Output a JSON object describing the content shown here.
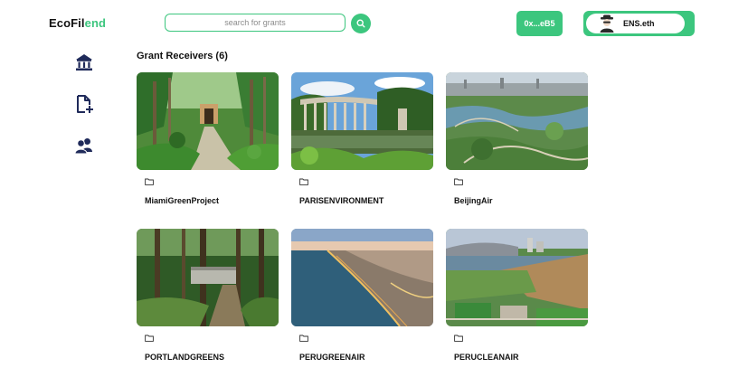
{
  "header": {
    "logo_part1": "EcoFil",
    "logo_part2": "end",
    "search_placeholder": "search for grants",
    "search_icon": "search-icon",
    "wallet_address": "0x...eB5",
    "ens_name": "ENS.eth",
    "avatar_icon": "spy-avatar-icon"
  },
  "sidebar": {
    "items": [
      {
        "icon": "bank-icon"
      },
      {
        "icon": "file-add-icon"
      },
      {
        "icon": "users-icon"
      }
    ]
  },
  "main": {
    "title": "Grant Receivers (6)",
    "cards": [
      {
        "label": "MiamiGreenProject",
        "icon": "folder-icon"
      },
      {
        "label": "PARISENVIRONMENT",
        "icon": "folder-icon"
      },
      {
        "label": "BeijingAir",
        "icon": "folder-icon"
      },
      {
        "label": "PORTLANDGREENS",
        "icon": "folder-icon"
      },
      {
        "label": "PERUGREENAIR",
        "icon": "folder-icon"
      },
      {
        "label": "PERUCLEANAIR",
        "icon": "folder-icon"
      }
    ]
  },
  "colors": {
    "accent": "#3cc67e",
    "icon_navy": "#1f2a5a"
  }
}
